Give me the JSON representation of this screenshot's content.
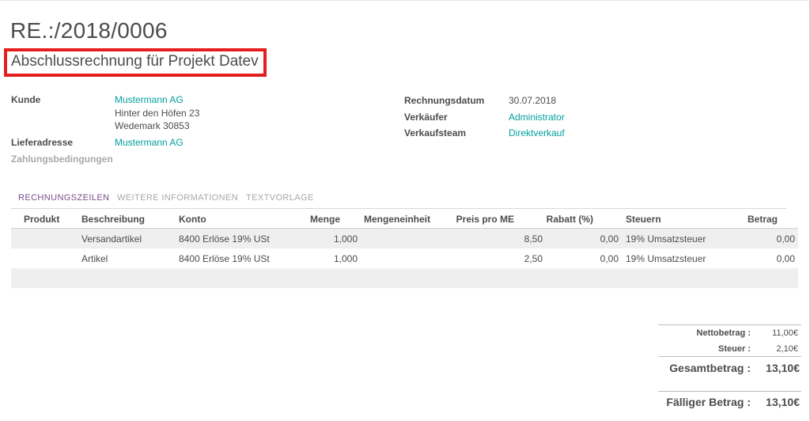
{
  "invoice": {
    "number": "RE.:/2018/0006",
    "title": "Abschlussrechnung für Projekt Datev"
  },
  "left_fields": {
    "customer_label": "Kunde",
    "customer_name": "Mustermann AG",
    "customer_street": "Hinter den Höfen 23",
    "customer_city": "Wedemark 30853",
    "delivery_label": "Lieferadresse",
    "delivery_value": "Mustermann AG",
    "payment_terms_label": "Zahlungsbedingungen"
  },
  "right_fields": {
    "date_label": "Rechnungsdatum",
    "date_value": "30.07.2018",
    "seller_label": "Verkäufer",
    "seller_value": "Administrator",
    "team_label": "Verkaufsteam",
    "team_value": "Direktverkauf"
  },
  "tabs": [
    {
      "label": "RECHNUNGSZEILEN",
      "active": true
    },
    {
      "label": "WEITERE INFORMATIONEN",
      "active": false
    },
    {
      "label": "TEXTVORLAGE",
      "active": false
    }
  ],
  "table": {
    "headers": [
      "Produkt",
      "Beschreibung",
      "Konto",
      "Menge",
      "Mengeneinheit",
      "Preis pro ME",
      "Rabatt (%)",
      "Steuern",
      "Betrag"
    ],
    "rows": [
      {
        "product": "",
        "description": "Versandartikel",
        "account": "8400 Erlöse 19% USt",
        "qty": "1,000",
        "uom": "",
        "price": "8,50",
        "discount": "0,00",
        "taxes": "19% Umsatzsteuer",
        "amount": "0,00"
      },
      {
        "product": "",
        "description": "Artikel",
        "account": "8400 Erlöse 19% USt",
        "qty": "1,000",
        "uom": "",
        "price": "2,50",
        "discount": "0,00",
        "taxes": "19% Umsatzsteuer",
        "amount": "0,00"
      }
    ]
  },
  "totals": {
    "net_label": "Nettobetrag :",
    "net_value": "11,00€",
    "tax_label": "Steuer :",
    "tax_value": "2,10€",
    "total_label": "Gesamtbetrag :",
    "total_value": "13,10€",
    "due_label": "Fälliger Betrag :",
    "due_value": "13,10€"
  },
  "colors": {
    "link": "#00a09d",
    "active_tab": "#7c4c8c",
    "highlight_box": "#e41d1d"
  }
}
